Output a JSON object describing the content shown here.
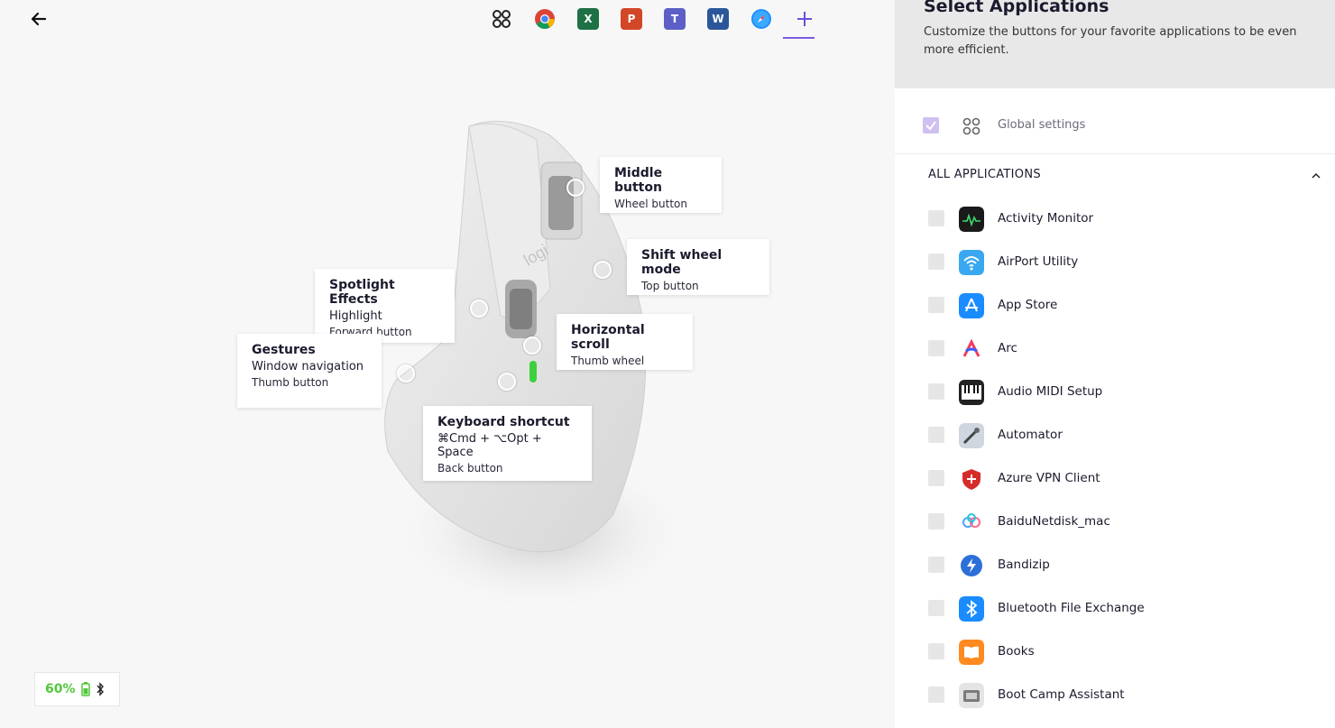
{
  "battery": {
    "percent": "60%"
  },
  "app_tabs": [
    "Global",
    "Google Chrome",
    "Microsoft Excel",
    "Microsoft PowerPoint",
    "Microsoft Teams",
    "Microsoft Word",
    "Safari",
    "Add application"
  ],
  "callouts": {
    "middle": {
      "title": "Middle button",
      "sub": "Wheel button"
    },
    "shift": {
      "title": "Shift wheel mode",
      "sub": "Top button"
    },
    "spotlight": {
      "title": "Spotlight Effects",
      "action": "Highlight",
      "sub": "Forward button"
    },
    "horizontal": {
      "title": "Horizontal scroll",
      "sub": "Thumb wheel"
    },
    "gestures": {
      "title": "Gestures",
      "action": "Window navigation",
      "sub": "Thumb button"
    },
    "keyboard": {
      "title": "Keyboard shortcut",
      "action": "⌘Cmd + ⌥Opt + Space",
      "sub": "Back button"
    }
  },
  "panel": {
    "title": "Select Applications",
    "description": "Customize the buttons for your favorite applications to be even more efficient.",
    "global_label": "Global settings",
    "global_checked": true,
    "section_label": "ALL APPLICATIONS",
    "apps": [
      {
        "name": "Activity Monitor",
        "icon": "activity-monitor-icon",
        "checked": false
      },
      {
        "name": "AirPort Utility",
        "icon": "airport-utility-icon",
        "checked": false
      },
      {
        "name": "App Store",
        "icon": "app-store-icon",
        "checked": false
      },
      {
        "name": "Arc",
        "icon": "arc-icon",
        "checked": false
      },
      {
        "name": "Audio MIDI Setup",
        "icon": "audio-midi-icon",
        "checked": false
      },
      {
        "name": "Automator",
        "icon": "automator-icon",
        "checked": false
      },
      {
        "name": "Azure VPN Client",
        "icon": "azure-vpn-icon",
        "checked": false
      },
      {
        "name": "BaiduNetdisk_mac",
        "icon": "baidu-netdisk-icon",
        "checked": false
      },
      {
        "name": "Bandizip",
        "icon": "bandizip-icon",
        "checked": false
      },
      {
        "name": "Bluetooth File Exchange",
        "icon": "bluetooth-icon",
        "checked": false
      },
      {
        "name": "Books",
        "icon": "books-icon",
        "checked": false
      },
      {
        "name": "Boot Camp Assistant",
        "icon": "boot-camp-icon",
        "checked": false
      }
    ]
  },
  "colors": {
    "accent": "#7b5be0",
    "battery": "#54c63a",
    "panel_header": "#e8e8e8"
  }
}
